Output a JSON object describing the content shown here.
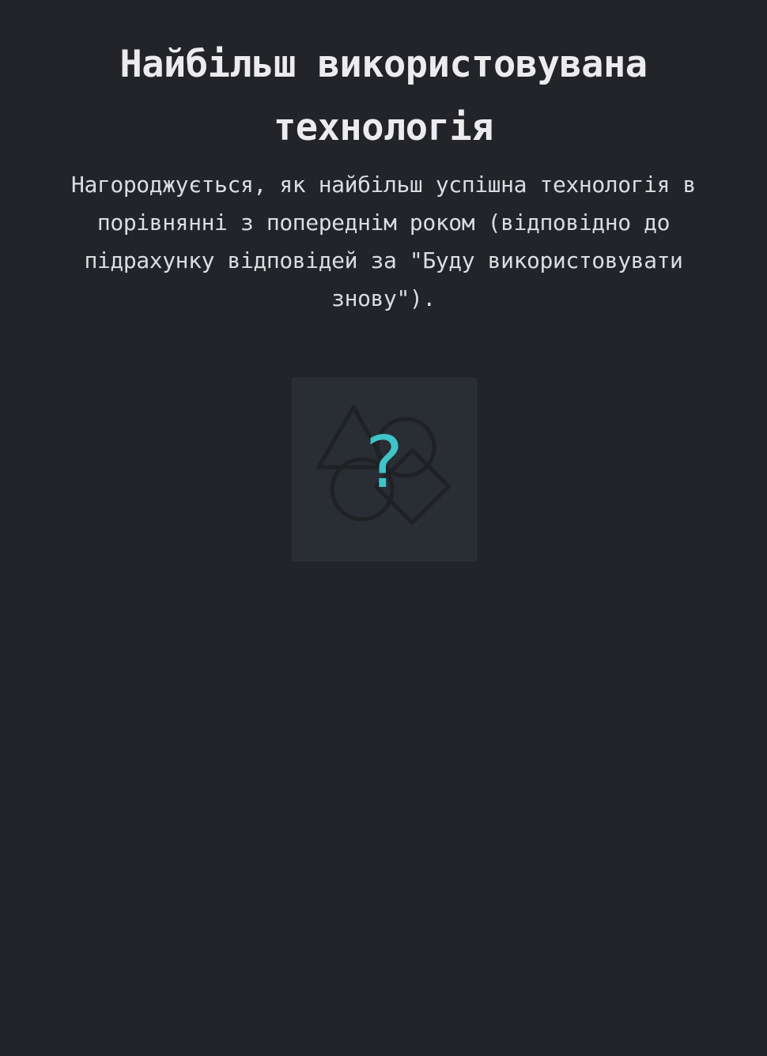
{
  "award": {
    "title": "Найбільш використовувана технологія",
    "description": "Нагороджується, як найбільш успішна технологія в порівнянні з попереднім роком (відповідно до підрахунку відповідей за \"Буду використовувати знову\")."
  },
  "placeholder": {
    "icon": "shapes-icon",
    "glyph": "?",
    "accent_color": "#3fc4c8",
    "background_color": "#232429"
  }
}
